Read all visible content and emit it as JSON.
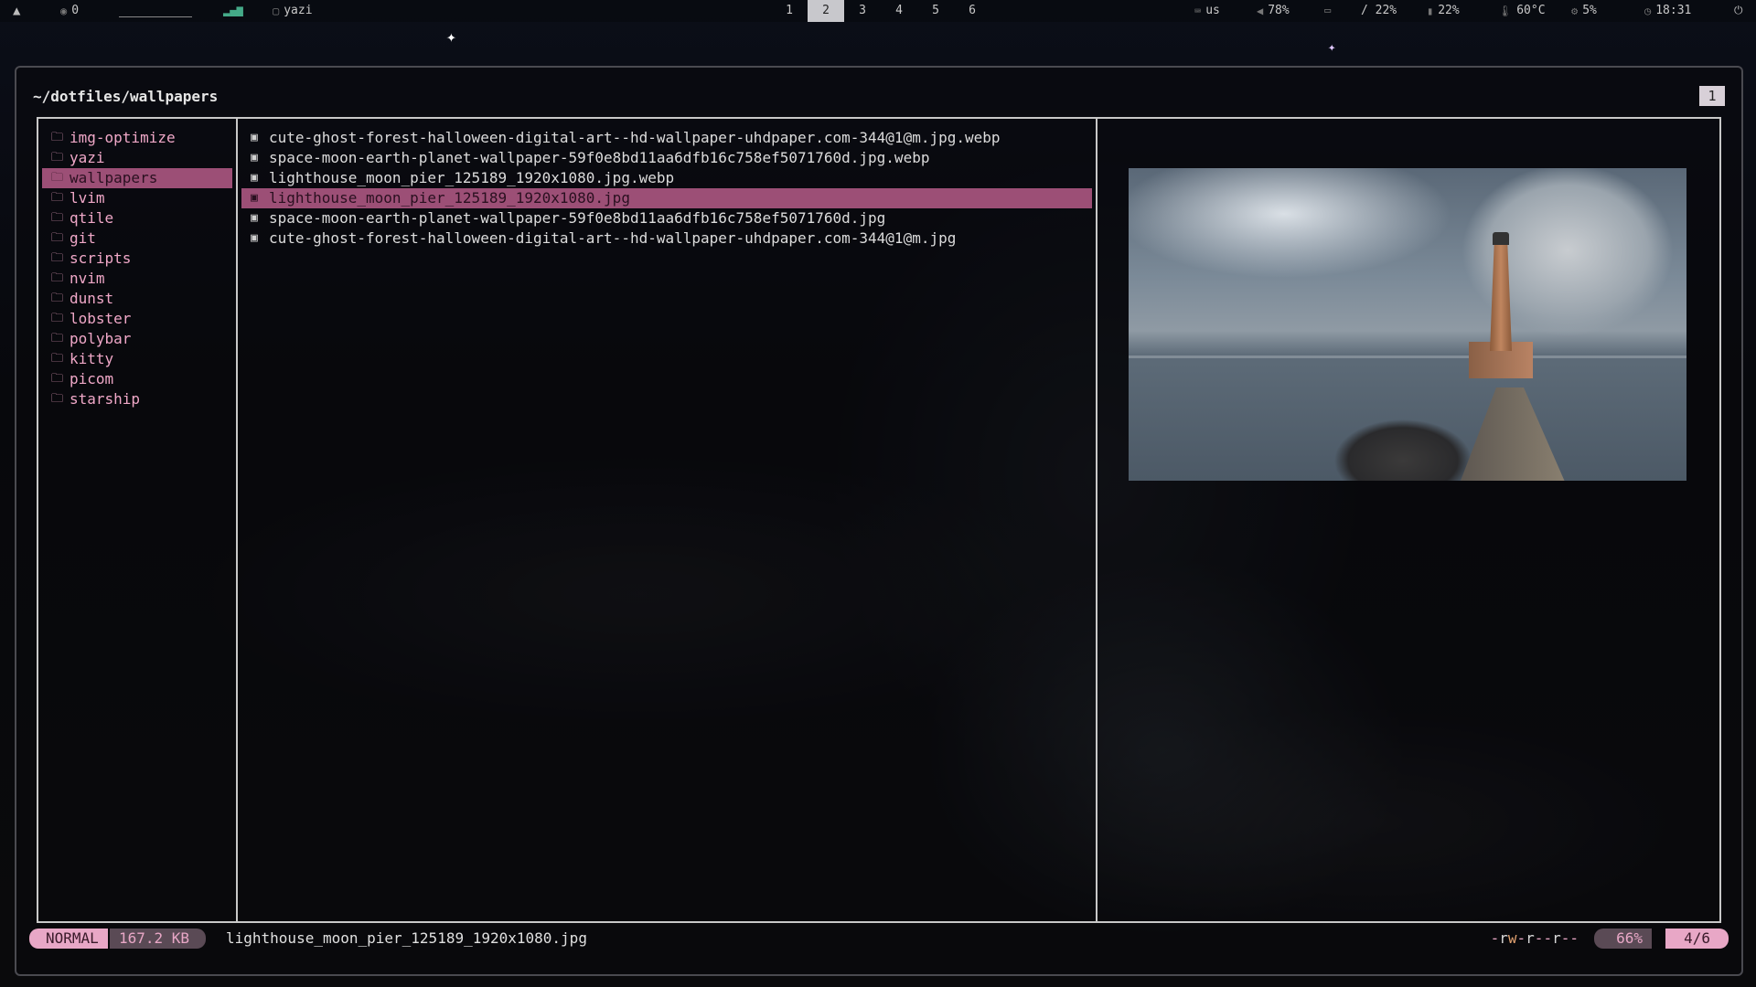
{
  "topbar": {
    "launcher_icon": "arch-logo-icon",
    "notif_count": "0",
    "signal_icon": "signal-bars-icon",
    "window_title": "yazi",
    "workspaces": [
      "1",
      "2",
      "3",
      "4",
      "5",
      "6"
    ],
    "active_workspace": "2",
    "keyboard_layout": "us",
    "volume": "78%",
    "disk": "/ 22%",
    "memory": "22%",
    "temperature": "60°C",
    "cpu": "5%",
    "clock": "18:31"
  },
  "yazi": {
    "cwd": "~/dotfiles/wallpapers",
    "tab_number": "1",
    "parent_items": [
      "img-optimize",
      "yazi",
      "wallpapers",
      "lvim",
      "qtile",
      "git",
      "scripts",
      "nvim",
      "dunst",
      "lobster",
      "polybar",
      "kitty",
      "picom",
      "starship"
    ],
    "parent_selected": "wallpapers",
    "files": [
      "cute-ghost-forest-halloween-digital-art--hd-wallpaper-uhdpaper.com-344@1@m.jpg.webp",
      "space-moon-earth-planet-wallpaper-59f0e8bd11aa6dfb16c758ef5071760d.jpg.webp",
      "lighthouse_moon_pier_125189_1920x1080.jpg.webp",
      "lighthouse_moon_pier_125189_1920x1080.jpg",
      "space-moon-earth-planet-wallpaper-59f0e8bd11aa6dfb16c758ef5071760d.jpg",
      "cute-ghost-forest-halloween-digital-art--hd-wallpaper-uhdpaper.com-344@1@m.jpg"
    ],
    "selected_file": "lighthouse_moon_pier_125189_1920x1080.jpg",
    "preview_subject": "lighthouse-moon-pier-preview",
    "status": {
      "mode": "NORMAL",
      "size": "167.2 KB",
      "filename": "lighthouse_moon_pier_125189_1920x1080.jpg",
      "perm_type": "-",
      "perm_owner_r": "r",
      "perm_owner_w": "w",
      "perm_owner_x": "-",
      "perm_group_r": "r",
      "perm_group_w": "-",
      "perm_group_x": "-",
      "perm_other_r": "r",
      "perm_other_w": "-",
      "perm_other_x": "-",
      "percent": "66%",
      "position": "4/6"
    }
  },
  "colors": {
    "accent_pink": "#e8a7c6",
    "selection_bg": "#9c4f76",
    "dir_text": "#f0a8c8"
  }
}
